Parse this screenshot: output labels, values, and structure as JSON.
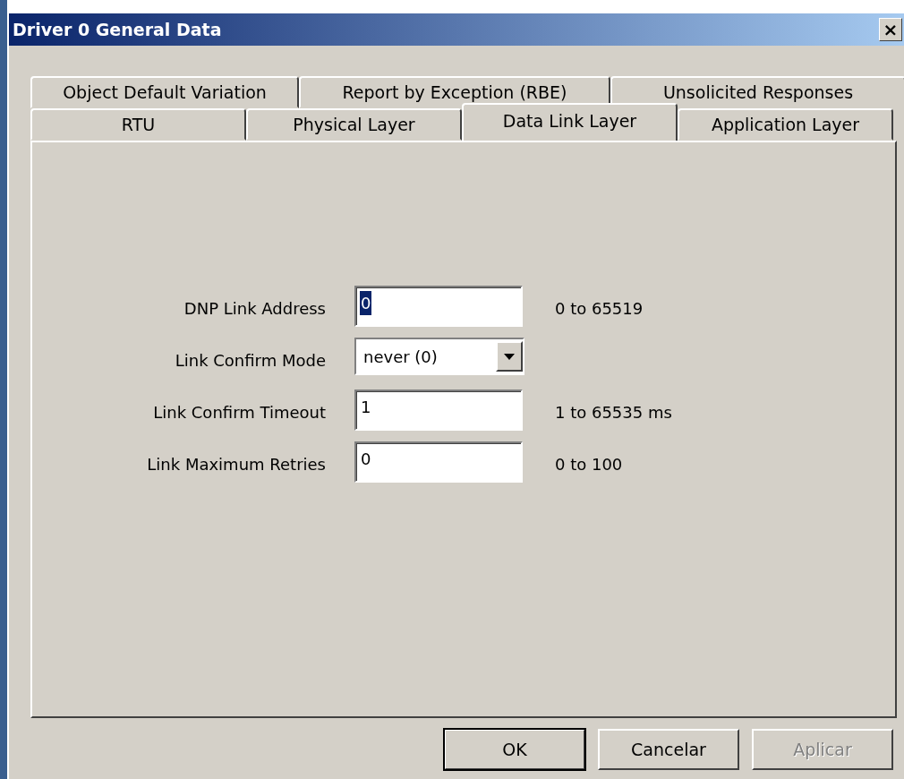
{
  "window": {
    "title": "Driver 0 General Data",
    "close": "×"
  },
  "tab_rows": [
    [
      {
        "label": "Object Default Variation",
        "selected": false
      },
      {
        "label": "Report by Exception (RBE)",
        "selected": false
      },
      {
        "label": "Unsolicited Responses",
        "selected": false
      }
    ],
    [
      {
        "label": "RTU",
        "selected": false
      },
      {
        "label": "Physical Layer",
        "selected": false
      },
      {
        "label": "Data Link Layer",
        "selected": true
      },
      {
        "label": "Application Layer",
        "selected": false
      }
    ]
  ],
  "fields": [
    {
      "kind": "text",
      "label": "DNP Link Address",
      "value": "0",
      "text_selected": true,
      "hint": "0 to 65519"
    },
    {
      "kind": "select",
      "label": "Link Confirm Mode",
      "value": "never (0)"
    },
    {
      "kind": "text",
      "label": "Link Confirm Timeout",
      "value": "1",
      "text_selected": false,
      "hint": "1 to 65535 ms"
    },
    {
      "kind": "text",
      "label": "Link Maximum Retries",
      "value": "0",
      "text_selected": false,
      "hint": "0 to 100"
    }
  ],
  "buttons": [
    {
      "label": "OK",
      "default": true,
      "disabled": false
    },
    {
      "label": "Cancelar",
      "default": false,
      "disabled": false
    },
    {
      "label": "Aplicar",
      "default": false,
      "disabled": true
    }
  ]
}
